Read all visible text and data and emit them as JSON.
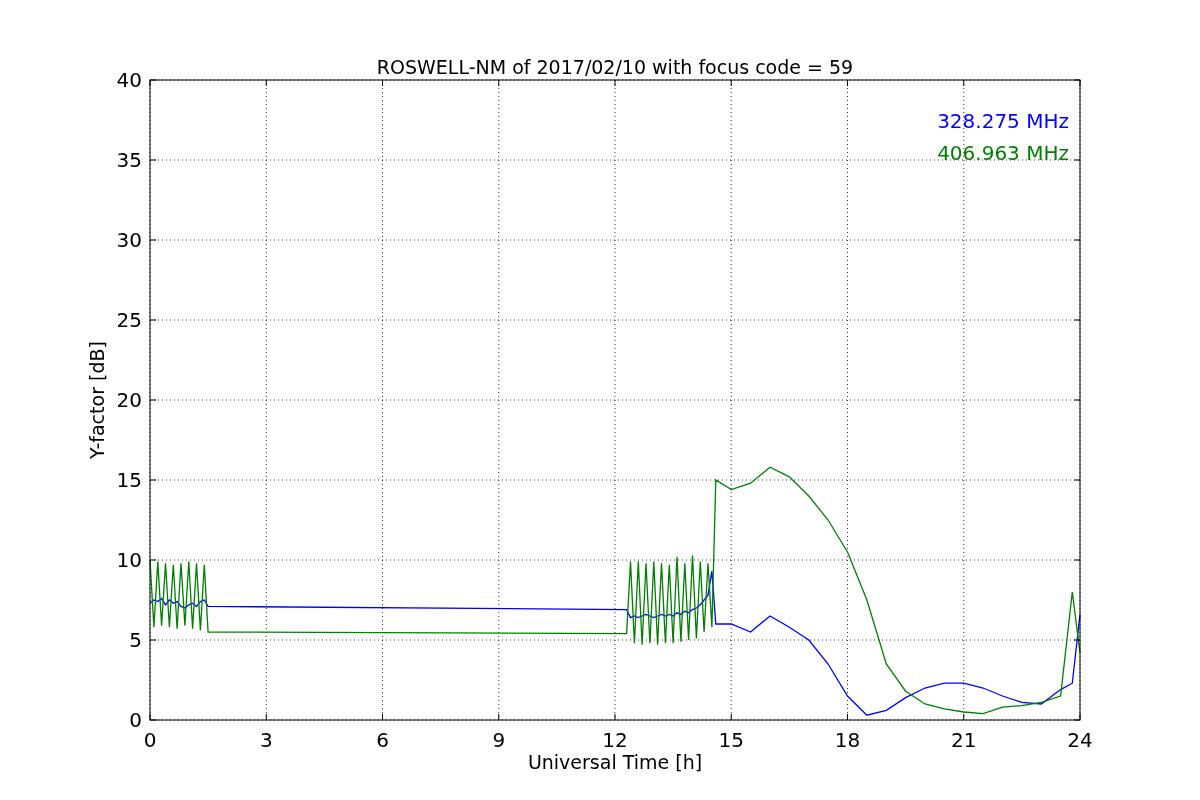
{
  "chart_data": {
    "type": "line",
    "title": "ROSWELL-NM of 2017/02/10 with focus code = 59",
    "xlabel": "Universal Time [h]",
    "ylabel": "Y-factor [dB]",
    "xlim": [
      0,
      24
    ],
    "ylim": [
      0,
      40
    ],
    "xticks": [
      0,
      3,
      6,
      9,
      12,
      15,
      18,
      21,
      24
    ],
    "yticks": [
      0,
      5,
      10,
      15,
      20,
      25,
      30,
      35,
      40
    ],
    "grid": true,
    "x": [
      0,
      0.1,
      0.2,
      0.3,
      0.4,
      0.5,
      0.6,
      0.7,
      0.8,
      0.9,
      1.0,
      1.1,
      1.2,
      1.3,
      1.4,
      1.5,
      12.3,
      12.4,
      12.5,
      12.6,
      12.7,
      12.8,
      12.9,
      13.0,
      13.1,
      13.2,
      13.3,
      13.4,
      13.5,
      13.6,
      13.7,
      13.8,
      13.9,
      14.0,
      14.1,
      14.2,
      14.3,
      14.4,
      14.5,
      14.6,
      15,
      15.5,
      16,
      16.5,
      17,
      17.5,
      18,
      18.5,
      19,
      19.5,
      20,
      20.5,
      21,
      21.5,
      22,
      22.5,
      23,
      23.5,
      23.8,
      24
    ],
    "series": [
      {
        "name": "328.275 MHz",
        "color": "#0000ff",
        "values": [
          7.3,
          7.5,
          7.4,
          7.6,
          7.2,
          7.5,
          7.3,
          7.4,
          7.1,
          7.0,
          7.2,
          7.3,
          7.1,
          7.4,
          7.5,
          7.1,
          6.9,
          6.4,
          6.5,
          6.4,
          6.5,
          6.6,
          6.5,
          6.4,
          6.5,
          6.6,
          6.5,
          6.6,
          6.5,
          6.7,
          6.6,
          6.8,
          6.7,
          6.9,
          7.0,
          7.2,
          7.5,
          7.8,
          9.3,
          6.0,
          6.0,
          5.5,
          6.5,
          5.8,
          5.0,
          3.5,
          1.5,
          0.3,
          0.6,
          1.4,
          2.0,
          2.3,
          2.3,
          2.0,
          1.5,
          1.1,
          1.0,
          1.9,
          2.3,
          6.6
        ]
      },
      {
        "name": "406.963 MHz",
        "color": "#008000",
        "values": [
          10,
          5.8,
          9.9,
          5.9,
          9.8,
          5.8,
          9.7,
          5.7,
          9.8,
          5.9,
          9.9,
          5.7,
          9.8,
          5.6,
          9.7,
          5.5,
          5.4,
          9.9,
          4.8,
          9.9,
          4.7,
          9.8,
          4.8,
          9.9,
          4.7,
          9.8,
          4.8,
          9.7,
          4.8,
          10.2,
          4.9,
          9.8,
          5.0,
          10.3,
          5.1,
          9.9,
          5.5,
          9.8,
          5.8,
          15.0,
          14.4,
          14.8,
          15.8,
          15.2,
          14.0,
          12.5,
          10.5,
          7.5,
          3.5,
          1.8,
          1.0,
          0.7,
          0.5,
          0.4,
          0.8,
          0.9,
          1.1,
          1.5,
          8.0,
          4.2
        ]
      }
    ]
  }
}
